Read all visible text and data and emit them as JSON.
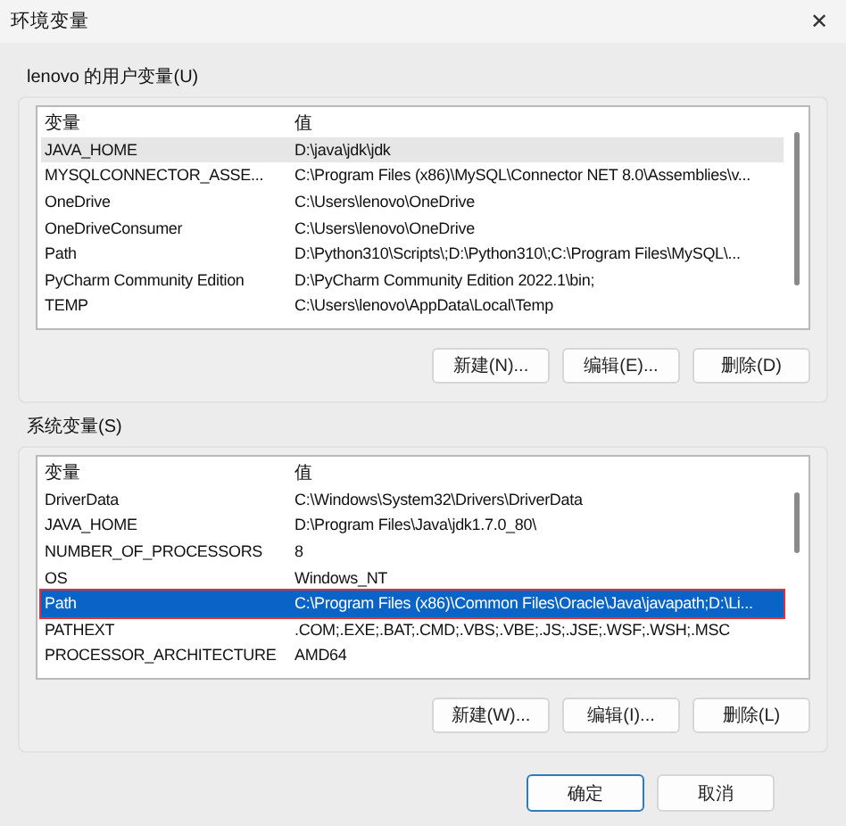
{
  "window": {
    "title": "环境变量",
    "close": "✕"
  },
  "user_group": {
    "label": "lenovo 的用户变量(U)",
    "focused": false,
    "columns": [
      "变量",
      "值"
    ],
    "rows": [
      {
        "name": "JAVA_HOME",
        "value": "D:\\java\\jdk\\jdk",
        "selected": true,
        "annotated": false
      },
      {
        "name": "MYSQLCONNECTOR_ASSE...",
        "value": "C:\\Program Files (x86)\\MySQL\\Connector NET 8.0\\Assemblies\\v...",
        "selected": false,
        "annotated": false
      },
      {
        "name": "OneDrive",
        "value": "C:\\Users\\lenovo\\OneDrive",
        "selected": false,
        "annotated": false
      },
      {
        "name": "OneDriveConsumer",
        "value": "C:\\Users\\lenovo\\OneDrive",
        "selected": false,
        "annotated": false
      },
      {
        "name": "Path",
        "value": "D:\\Python310\\Scripts\\;D:\\Python310\\;C:\\Program Files\\MySQL\\...",
        "selected": false,
        "annotated": false
      },
      {
        "name": "PyCharm Community Edition",
        "value": "D:\\PyCharm Community Edition 2022.1\\bin;",
        "selected": false,
        "annotated": false
      },
      {
        "name": "TEMP",
        "value": "C:\\Users\\lenovo\\AppData\\Local\\Temp",
        "selected": false,
        "annotated": false
      }
    ],
    "buttons": [
      "新建(N)...",
      "编辑(E)...",
      "删除(D)"
    ]
  },
  "system_group": {
    "label": "系统变量(S)",
    "focused": true,
    "columns": [
      "变量",
      "值"
    ],
    "rows": [
      {
        "name": "DriverData",
        "value": "C:\\Windows\\System32\\Drivers\\DriverData",
        "selected": false,
        "annotated": false
      },
      {
        "name": "JAVA_HOME",
        "value": "D:\\Program Files\\Java\\jdk1.7.0_80\\",
        "selected": false,
        "annotated": false
      },
      {
        "name": "NUMBER_OF_PROCESSORS",
        "value": "8",
        "selected": false,
        "annotated": false
      },
      {
        "name": "OS",
        "value": "Windows_NT",
        "selected": false,
        "annotated": false
      },
      {
        "name": "Path",
        "value": "C:\\Program Files (x86)\\Common Files\\Oracle\\Java\\javapath;D:\\Li...",
        "selected": true,
        "annotated": true
      },
      {
        "name": "PATHEXT",
        "value": ".COM;.EXE;.BAT;.CMD;.VBS;.VBE;.JS;.JSE;.WSF;.WSH;.MSC",
        "selected": false,
        "annotated": false
      },
      {
        "name": "PROCESSOR_ARCHITECTURE",
        "value": "AMD64",
        "selected": false,
        "annotated": false
      }
    ],
    "buttons": [
      "新建(W)...",
      "编辑(I)...",
      "删除(L)"
    ]
  },
  "footer_buttons": [
    {
      "label": "确定",
      "default": true
    },
    {
      "label": "取消",
      "default": false
    }
  ]
}
